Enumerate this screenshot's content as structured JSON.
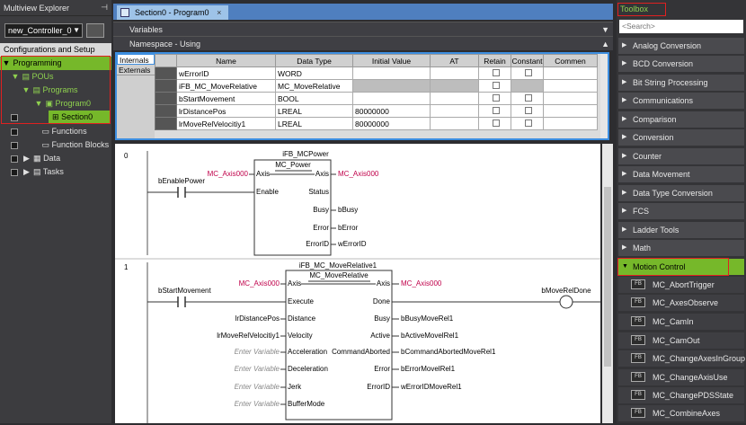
{
  "explorer": {
    "title": "Multiview Explorer",
    "pin": "⊣",
    "controller": "new_Controller_0",
    "tree": [
      {
        "label": "Configurations and Setup",
        "twist": ""
      },
      {
        "label": "Programming",
        "twist": "▼"
      },
      {
        "label": "POUs",
        "twist": "▼"
      },
      {
        "label": "Programs",
        "twist": "▼"
      },
      {
        "label": "Program0",
        "twist": "▼"
      },
      {
        "label": "Section0",
        "twist": ""
      },
      {
        "label": "Functions",
        "twist": ""
      },
      {
        "label": "Function Blocks",
        "twist": ""
      },
      {
        "label": "Data",
        "twist": "▶"
      },
      {
        "label": "Tasks",
        "twist": "▶"
      }
    ]
  },
  "editor": {
    "tab_label": "Section0 - Program0",
    "tab_close": "×",
    "variables_label": "Variables",
    "namespace_label": "Namespace - Using",
    "side_tabs": [
      "Internals",
      "Externals"
    ],
    "columns": [
      "Name",
      "Data Type",
      "Initial Value",
      "AT",
      "Retain",
      "Constant",
      "Commen"
    ],
    "rows": [
      {
        "name": "wErrorID",
        "type": "WORD",
        "init": ""
      },
      {
        "name": "iFB_MC_MoveRelative",
        "type": "MC_MoveRelative",
        "init": ""
      },
      {
        "name": "bStartMovement",
        "type": "BOOL",
        "init": ""
      },
      {
        "name": "lrDistancePos",
        "type": "LREAL",
        "init": "80000000"
      },
      {
        "name": "lrMoveRelVelocitiy1",
        "type": "LREAL",
        "init": "80000000"
      }
    ]
  },
  "ladder": {
    "rung0": {
      "num": "0",
      "instance": "iFB_MCPower",
      "fb_type": "MC_Power",
      "contact": "bEnablePower",
      "axis_in": "MC_Axis000",
      "axis_out": "MC_Axis000",
      "inputs": [
        "Axis",
        "Enable"
      ],
      "outputs": [
        "Axis",
        "Status",
        "Busy",
        "Error",
        "ErrorID"
      ],
      "out_vars": [
        "bBusy",
        "bError",
        "wErrorID"
      ]
    },
    "rung1": {
      "num": "1",
      "instance": "iFB_MC_MoveRelative1",
      "fb_type": "MC_MoveRelative",
      "contact": "bStartMovement",
      "coil": "bMoveRelDone",
      "axis_in": "MC_Axis000",
      "axis_out": "MC_Axis000",
      "inputs": [
        "Axis",
        "Execute",
        "Distance",
        "Velocity",
        "Acceleration",
        "Deceleration",
        "Jerk",
        "BufferMode"
      ],
      "outputs": [
        "Axis",
        "Done",
        "Busy",
        "Active",
        "CommandAborted",
        "Error",
        "ErrorID"
      ],
      "in_vars": [
        "lrDistancePos",
        "lrMoveRelVelocitiy1",
        "Enter Variable",
        "Enter Variable",
        "Enter Variable",
        "Enter Variable"
      ],
      "out_vars": [
        "bBusyMoveRel1",
        "bActiveMovelRel1",
        "bCommandAbortedMoveRel1",
        "bErrorMovelRel1",
        "wErrorIDMoveRel1"
      ]
    }
  },
  "toolbox": {
    "title": "Toolbox",
    "search_placeholder": "<Search>",
    "categories": [
      "Analog Conversion",
      "BCD Conversion",
      "Bit String Processing",
      "Communications",
      "Comparison",
      "Conversion",
      "Counter",
      "Data Movement",
      "Data Type Conversion",
      "FCS",
      "Ladder Tools",
      "Math",
      "Motion Control"
    ],
    "fb_tag": "FB",
    "items": [
      "MC_AbortTrigger",
      "MC_AxesObserve",
      "MC_CamIn",
      "MC_CamOut",
      "MC_ChangeAxesInGroup",
      "MC_ChangeAxisUse",
      "MC_ChangePDSState",
      "MC_CombineAxes"
    ]
  },
  "colors": {
    "accent_green": "#76b82a",
    "highlight_red": "#e02020",
    "var_red": "#c0004a",
    "tab_blue": "#4f7fbf"
  }
}
